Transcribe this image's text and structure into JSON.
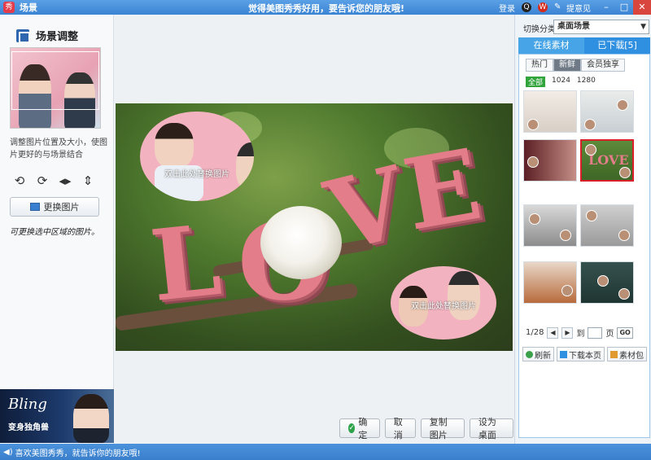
{
  "titlebar": {
    "app_logo": "秀",
    "window_title": "场景",
    "slogan": "觉得美图秀秀好用，要告诉您的朋友哦!",
    "login": "登录",
    "feedback": "提意见",
    "icons": [
      "qq-icon",
      "weibo-icon",
      "feedback-icon",
      "minimize-icon",
      "maximize-icon",
      "close-icon"
    ]
  },
  "left_panel": {
    "title": "场景调整",
    "help_text": "调整图片位置及大小，使图片更好的与场景结合",
    "tools": [
      "rotate-left-icon",
      "rotate-right-icon",
      "flip-horizontal-icon",
      "flip-vertical-icon"
    ],
    "replace_button": "更换图片",
    "hand_note": "可更换选中区域的图片。",
    "ad": {
      "title": "Bling",
      "subtitle": "变身独角兽"
    }
  },
  "canvas": {
    "letters": "LOVE",
    "photo_hint_1": "双击此处替换图片",
    "photo_hint_2": "双击此处替换图片"
  },
  "bottom_buttons": {
    "ok": "确定",
    "cancel": "取消",
    "copy": "复制图片",
    "set_desktop": "设为桌面"
  },
  "right_panel": {
    "category_label": "切换分类",
    "category_value": "桌面场景",
    "tab_online": "在线素材",
    "tab_downloaded": "已下载[5]",
    "sort": [
      "热门",
      "新鲜",
      "会员独享"
    ],
    "sizes": [
      "全部",
      "1024",
      "1280"
    ],
    "page_indicator": "1/28",
    "page_to": "到",
    "page_unit": "页",
    "go": "GO",
    "refresh": "刷新",
    "download_page": "下载本页",
    "material_pack": "素材包"
  },
  "statusbar": {
    "text": "喜欢美图秀秀，就告诉你的朋友哦!"
  },
  "colors": {
    "titlebar": "#3b84d4",
    "accent_pink": "#e47d8a",
    "selection_red": "#d8202a",
    "confirm_green": "#2fa34a"
  }
}
